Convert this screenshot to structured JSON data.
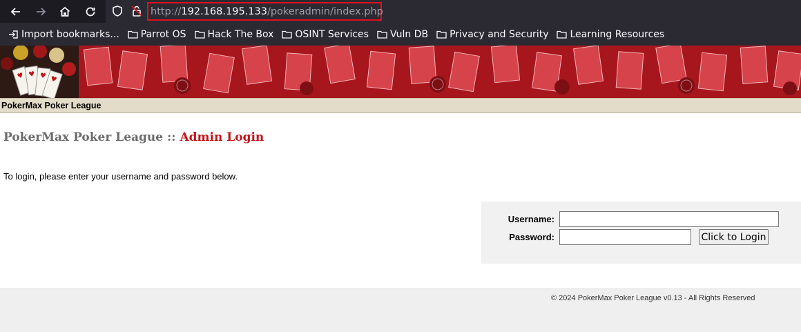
{
  "browser": {
    "url_scheme": "http://",
    "url_host": "192.168.195.133",
    "url_path": "/pokeradmin/index.php",
    "bookmarks": [
      {
        "label": "Import bookmarks...",
        "icon": "import-icon"
      },
      {
        "label": "Parrot OS",
        "icon": "folder-icon"
      },
      {
        "label": "Hack The Box",
        "icon": "folder-icon"
      },
      {
        "label": "OSINT Services",
        "icon": "folder-icon"
      },
      {
        "label": "Vuln DB",
        "icon": "folder-icon"
      },
      {
        "label": "Privacy and Security",
        "icon": "folder-icon"
      },
      {
        "label": "Learning Resources",
        "icon": "folder-icon"
      }
    ]
  },
  "site": {
    "title_bar": "PokerMax Poker League",
    "heading_prefix": "PokerMax Poker League :: ",
    "heading_accent": "Admin Login",
    "intro": "To login, please enter your username and password below."
  },
  "login": {
    "username_label": "Username:",
    "password_label": "Password:",
    "username_value": "",
    "password_value": "",
    "submit_label": "Click to Login"
  },
  "footer": {
    "copyright": "© 2024 PokerMax Poker League v0.13 - All Rights Reserved"
  },
  "colors": {
    "accent": "#c0151a",
    "chrome_bg": "#1c1b22",
    "urlbar_highlight": "#e0101c"
  }
}
